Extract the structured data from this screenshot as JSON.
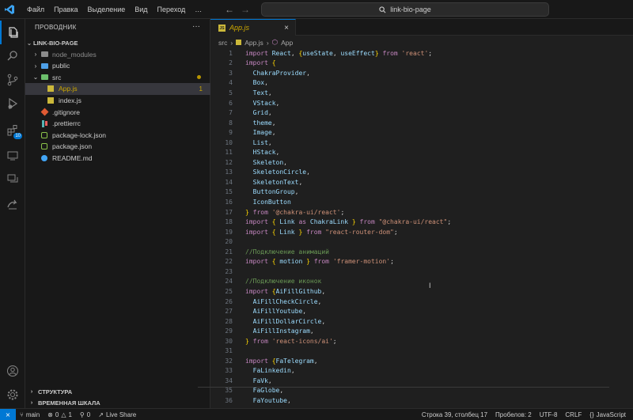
{
  "titlebar": {
    "menu": [
      "Файл",
      "Правка",
      "Выделение",
      "Вид",
      "Переход"
    ],
    "more": "…",
    "search": "link-bio-page"
  },
  "sidebar": {
    "title": "ПРОВОДНИК",
    "more": "···",
    "root": "LINK-BIO-PAGE",
    "items": [
      {
        "label": "node_modules",
        "twisty": "›",
        "kind": "folder",
        "color": "#8c8c8c",
        "indent": 0
      },
      {
        "label": "public",
        "twisty": "›",
        "kind": "folder",
        "color": "#4ea0e8",
        "indent": 0
      },
      {
        "label": "src",
        "twisty": "⌄",
        "kind": "folder",
        "color": "#6cbf6c",
        "indent": 0,
        "modified_dot": true
      },
      {
        "label": "App.js",
        "twisty": "",
        "kind": "js",
        "indent": 1,
        "selected": true,
        "problems": "1"
      },
      {
        "label": "index.js",
        "twisty": "",
        "kind": "js",
        "indent": 1
      },
      {
        "label": ".gitignore",
        "twisty": "",
        "kind": "git",
        "indent": 0
      },
      {
        "label": ".prettierrc",
        "twisty": "",
        "kind": "prettier",
        "indent": 0
      },
      {
        "label": "package-lock.json",
        "twisty": "",
        "kind": "npm",
        "indent": 0
      },
      {
        "label": "package.json",
        "twisty": "",
        "kind": "npm",
        "indent": 0
      },
      {
        "label": "README.md",
        "twisty": "",
        "kind": "info",
        "indent": 0
      }
    ],
    "panels": [
      "СТРУКТУРА",
      "ВРЕМЕННАЯ ШКАЛА"
    ]
  },
  "activity": {
    "extensions_badge": "10"
  },
  "editor": {
    "tab": {
      "name": "App.js",
      "close": "×"
    },
    "breadcrumb": [
      "src",
      "App.js",
      "App"
    ],
    "lines": [
      {
        "n": "1",
        "t": [
          [
            "kw",
            "import "
          ],
          [
            "var",
            "React"
          ],
          [
            "plain",
            ", "
          ],
          [
            "br1",
            "{"
          ],
          [
            "var",
            "useState"
          ],
          [
            "plain",
            ", "
          ],
          [
            "var",
            "useEffect"
          ],
          [
            "br1",
            "}"
          ],
          [
            "kw",
            " from "
          ],
          [
            "str",
            "'react'"
          ],
          [
            "plain",
            ";"
          ]
        ]
      },
      {
        "n": "2",
        "t": [
          [
            "kw",
            "import "
          ],
          [
            "br1",
            "{"
          ]
        ]
      },
      {
        "n": "3",
        "t": [
          [
            "plain",
            "  "
          ],
          [
            "var",
            "ChakraProvider"
          ],
          [
            "plain",
            ","
          ]
        ]
      },
      {
        "n": "4",
        "t": [
          [
            "plain",
            "  "
          ],
          [
            "var",
            "Box"
          ],
          [
            "plain",
            ","
          ]
        ]
      },
      {
        "n": "5",
        "t": [
          [
            "plain",
            "  "
          ],
          [
            "var",
            "Text"
          ],
          [
            "plain",
            ","
          ]
        ]
      },
      {
        "n": "6",
        "t": [
          [
            "plain",
            "  "
          ],
          [
            "var",
            "VStack"
          ],
          [
            "plain",
            ","
          ]
        ]
      },
      {
        "n": "7",
        "t": [
          [
            "plain",
            "  "
          ],
          [
            "var",
            "Grid"
          ],
          [
            "plain",
            ","
          ]
        ]
      },
      {
        "n": "8",
        "t": [
          [
            "plain",
            "  "
          ],
          [
            "var",
            "theme"
          ],
          [
            "plain",
            ","
          ]
        ]
      },
      {
        "n": "9",
        "t": [
          [
            "plain",
            "  "
          ],
          [
            "var",
            "Image"
          ],
          [
            "plain",
            ","
          ]
        ]
      },
      {
        "n": "10",
        "t": [
          [
            "plain",
            "  "
          ],
          [
            "var",
            "List"
          ],
          [
            "plain",
            ","
          ]
        ]
      },
      {
        "n": "11",
        "t": [
          [
            "plain",
            "  "
          ],
          [
            "var",
            "HStack"
          ],
          [
            "plain",
            ","
          ]
        ]
      },
      {
        "n": "12",
        "t": [
          [
            "plain",
            "  "
          ],
          [
            "var",
            "Skeleton"
          ],
          [
            "plain",
            ","
          ]
        ]
      },
      {
        "n": "13",
        "t": [
          [
            "plain",
            "  "
          ],
          [
            "var",
            "SkeletonCircle"
          ],
          [
            "plain",
            ","
          ]
        ]
      },
      {
        "n": "14",
        "t": [
          [
            "plain",
            "  "
          ],
          [
            "var",
            "SkeletonText"
          ],
          [
            "plain",
            ","
          ]
        ]
      },
      {
        "n": "15",
        "t": [
          [
            "plain",
            "  "
          ],
          [
            "var",
            "ButtonGroup"
          ],
          [
            "plain",
            ","
          ]
        ]
      },
      {
        "n": "16",
        "t": [
          [
            "plain",
            "  "
          ],
          [
            "var",
            "IconButton"
          ]
        ]
      },
      {
        "n": "17",
        "t": [
          [
            "br1",
            "}"
          ],
          [
            "kw",
            " from "
          ],
          [
            "str",
            "'@chakra-ui/react'"
          ],
          [
            "plain",
            ";"
          ]
        ]
      },
      {
        "n": "18",
        "t": [
          [
            "kw",
            "import "
          ],
          [
            "br1",
            "{ "
          ],
          [
            "var",
            "Link"
          ],
          [
            "kw",
            " as "
          ],
          [
            "var",
            "ChakraLink"
          ],
          [
            "br1",
            " }"
          ],
          [
            "kw",
            " from "
          ],
          [
            "str",
            "\"@chakra-ui/react\""
          ],
          [
            "plain",
            ";"
          ]
        ]
      },
      {
        "n": "19",
        "t": [
          [
            "kw",
            "import "
          ],
          [
            "br1",
            "{ "
          ],
          [
            "var",
            "Link"
          ],
          [
            "br1",
            " }"
          ],
          [
            "kw",
            " from "
          ],
          [
            "str",
            "\"react-router-dom\""
          ],
          [
            "plain",
            ";"
          ]
        ]
      },
      {
        "n": "20",
        "t": []
      },
      {
        "n": "21",
        "t": [
          [
            "cmt",
            "//Подключение анимаций"
          ]
        ]
      },
      {
        "n": "22",
        "t": [
          [
            "kw",
            "import "
          ],
          [
            "br1",
            "{ "
          ],
          [
            "var",
            "motion"
          ],
          [
            "br1",
            " }"
          ],
          [
            "kw",
            " from "
          ],
          [
            "str",
            "'framer-motion'"
          ],
          [
            "plain",
            ";"
          ]
        ]
      },
      {
        "n": "23",
        "t": []
      },
      {
        "n": "24",
        "t": [
          [
            "cmt",
            "//Подключение иконок"
          ]
        ]
      },
      {
        "n": "25",
        "t": [
          [
            "kw",
            "import "
          ],
          [
            "br1",
            "{"
          ],
          [
            "var",
            "AiFillGithub"
          ],
          [
            "plain",
            ","
          ]
        ]
      },
      {
        "n": "26",
        "t": [
          [
            "plain",
            "  "
          ],
          [
            "var",
            "AiFillCheckCircle"
          ],
          [
            "plain",
            ","
          ]
        ]
      },
      {
        "n": "27",
        "t": [
          [
            "plain",
            "  "
          ],
          [
            "var",
            "AiFillYoutube"
          ],
          [
            "plain",
            ","
          ]
        ]
      },
      {
        "n": "28",
        "t": [
          [
            "plain",
            "  "
          ],
          [
            "var",
            "AiFillDollarCircle"
          ],
          [
            "plain",
            ","
          ]
        ]
      },
      {
        "n": "29",
        "t": [
          [
            "plain",
            "  "
          ],
          [
            "var",
            "AiFillInstagram"
          ],
          [
            "plain",
            ","
          ]
        ]
      },
      {
        "n": "30",
        "t": [
          [
            "br1",
            "}"
          ],
          [
            "kw",
            " from "
          ],
          [
            "str",
            "'react-icons/ai'"
          ],
          [
            "plain",
            ";"
          ]
        ]
      },
      {
        "n": "31",
        "t": []
      },
      {
        "n": "32",
        "t": [
          [
            "kw",
            "import "
          ],
          [
            "br1",
            "{"
          ],
          [
            "var",
            "FaTelegram"
          ],
          [
            "plain",
            ","
          ]
        ]
      },
      {
        "n": "33",
        "t": [
          [
            "plain",
            "  "
          ],
          [
            "var",
            "FaLinkedin"
          ],
          [
            "plain",
            ","
          ]
        ]
      },
      {
        "n": "34",
        "t": [
          [
            "plain",
            "  "
          ],
          [
            "var",
            "FaVk"
          ],
          [
            "plain",
            ","
          ]
        ]
      },
      {
        "n": "35",
        "t": [
          [
            "plain",
            "  "
          ],
          [
            "var",
            "FaGlobe"
          ],
          [
            "plain",
            ","
          ]
        ]
      },
      {
        "n": "36",
        "t": [
          [
            "plain",
            "  "
          ],
          [
            "var",
            "FaYoutube"
          ],
          [
            "plain",
            ","
          ]
        ]
      }
    ]
  },
  "statusbar": {
    "branch": "main",
    "errors": "0",
    "warnings": "1",
    "ports": "0",
    "live_share": "Live Share",
    "position": "Строка 39, столбец 17",
    "spaces": "Пробелов: 2",
    "encoding": "UTF-8",
    "eol": "CRLF",
    "language": "JavaScript"
  },
  "colors": {
    "accent": "#0078d4",
    "modified": "#cca700",
    "bg": "#1f1f1f"
  }
}
